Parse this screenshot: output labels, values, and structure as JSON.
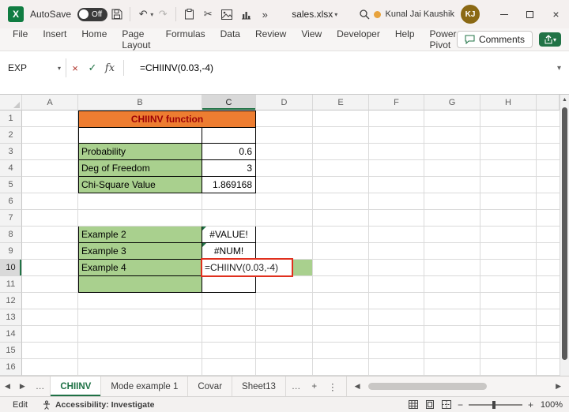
{
  "titlebar": {
    "app": "Excel",
    "autosave_label": "AutoSave",
    "autosave_state": "Off",
    "filename": "sales.xlsx",
    "user_name": "Kunal Jai Kaushik",
    "user_initials": "KJ"
  },
  "menubar": {
    "items": [
      "File",
      "Insert",
      "Home",
      "Page Layout",
      "Formulas",
      "Data",
      "Review",
      "View",
      "Developer",
      "Help",
      "Power Pivot"
    ],
    "comments_label": "Comments"
  },
  "formula_bar": {
    "name_box": "EXP",
    "formula": "=CHIINV(0.03,-4)"
  },
  "grid": {
    "columns": [
      "A",
      "B",
      "C",
      "D",
      "E",
      "F",
      "G",
      "H"
    ],
    "row_count": 16,
    "selected_column": "C",
    "selected_row": 10
  },
  "cells": {
    "B1": "CHIINV function",
    "B3": "Probability",
    "C3": "0.6",
    "B4": "Deg of Freedom",
    "C4": "3",
    "B5": "Chi-Square Value",
    "C5": "1.869168",
    "B8": "Example 2",
    "C8": "#VALUE!",
    "B9": "Example 3",
    "C9": "#NUM!",
    "B10": "Example 4",
    "C10": "=CHIINV(0.03,-4)"
  },
  "sheet_tabs": {
    "tabs": [
      {
        "label": "CHIINV",
        "active": true
      },
      {
        "label": "Mode example 1",
        "active": false
      },
      {
        "label": "Covar",
        "active": false
      },
      {
        "label": "Sheet13",
        "active": false
      }
    ]
  },
  "status_bar": {
    "mode": "Edit",
    "accessibility": "Accessibility: Investigate",
    "zoom": "100%"
  },
  "colors": {
    "excel_green": "#217346",
    "header_orange": "#ED7D31",
    "title_text_red": "#9C0006",
    "cell_green": "#A9D08E",
    "edit_border_red": "#E0301E",
    "avatar_gold": "#8B6914"
  }
}
